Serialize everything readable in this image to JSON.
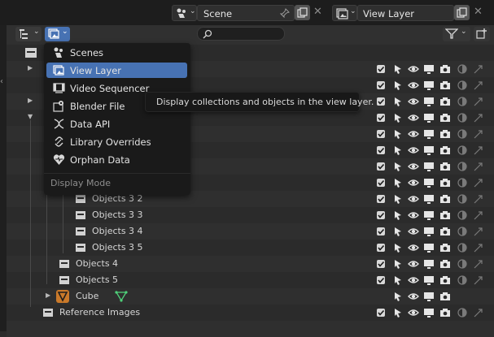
{
  "topbar": {
    "scene_label": "Scene",
    "view_layer_label": "View Layer"
  },
  "header": {
    "search_placeholder": ""
  },
  "menu": {
    "items": [
      {
        "label": "Scenes",
        "icon": "scenes-icon"
      },
      {
        "label": "View Layer",
        "icon": "view-layer-icon"
      },
      {
        "label": "Video Sequencer",
        "icon": "video-sequencer-icon"
      },
      {
        "label": "Blender File",
        "icon": "blender-file-icon"
      },
      {
        "label": "Data API",
        "icon": "data-api-icon"
      },
      {
        "label": "Library Overrides",
        "icon": "library-overrides-icon"
      },
      {
        "label": "Orphan Data",
        "icon": "orphan-data-icon"
      }
    ],
    "active_index": 1,
    "section_label": "Display Mode"
  },
  "tooltip": {
    "text": "Display collections and objects in the view layer."
  },
  "outliner": {
    "rows": [
      {
        "label": "Objects 3 2"
      },
      {
        "label": "Objects 3 3"
      },
      {
        "label": "Objects 3 4"
      },
      {
        "label": "Objects 3 5"
      },
      {
        "label": "Objects 4"
      },
      {
        "label": "Objects 5"
      },
      {
        "label": "Cube"
      },
      {
        "label": "Reference Images"
      }
    ]
  },
  "colors": {
    "accent": "#4772b3",
    "cube_orange": "#e8a23a",
    "mesh_green": "#4fd17a"
  }
}
